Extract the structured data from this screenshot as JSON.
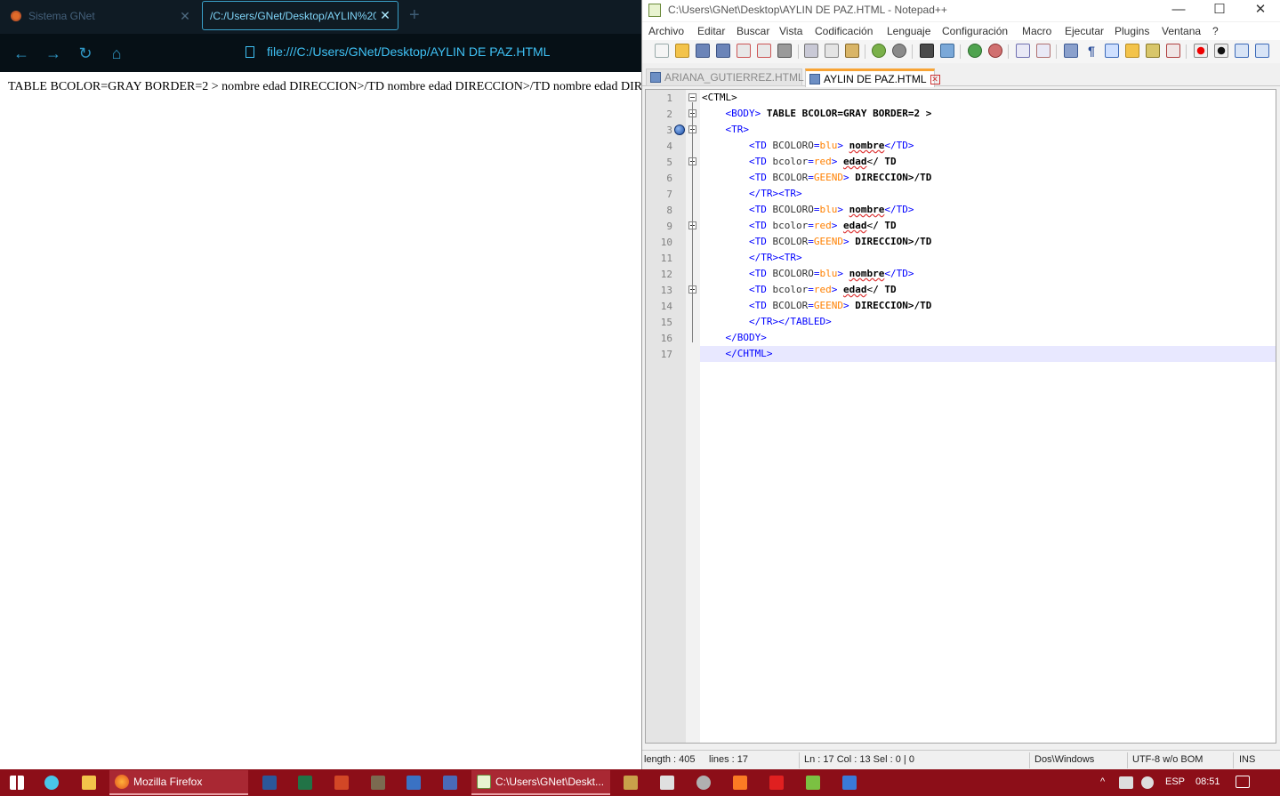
{
  "firefox": {
    "tabs": [
      {
        "title": "Sistema GNet",
        "active": false
      },
      {
        "title": "/C:/Users/GNet/Desktop/AYLIN%20",
        "active": true
      }
    ],
    "new_tab": "+",
    "url": "file:///C:/Users/GNet/Desktop/AYLIN DE PAZ.HTML",
    "content_text": "TABLE BCOLOR=GRAY BORDER=2 > nombre edad DIRECCION>/TD nombre edad DIRECCION>/TD nombre edad DIRECCION>/TD",
    "nav": {
      "back": "←",
      "forward": "→",
      "reload": "↻",
      "home": "⌂"
    }
  },
  "notepad": {
    "title": "C:\\Users\\GNet\\Desktop\\AYLIN DE PAZ.HTML - Notepad++",
    "window_controls": {
      "minimize": "—",
      "maximize": "☐",
      "close": "✕"
    },
    "menu": [
      "Archivo",
      "Editar",
      "Buscar",
      "Vista",
      "Codificación",
      "Lenguaje",
      "Configuración",
      "Macro",
      "Ejecutar",
      "Plugins",
      "Ventana",
      "?"
    ],
    "doc_tabs": [
      {
        "label": "ARIANA_GUTIERREZ.HTML",
        "active": false
      },
      {
        "label": "AYLIN DE PAZ.HTML",
        "active": true
      }
    ],
    "line_numbers": [
      "1",
      "2",
      "3",
      "4",
      "5",
      "6",
      "7",
      "8",
      "9",
      "10",
      "11",
      "12",
      "13",
      "14",
      "15",
      "16",
      "17"
    ],
    "code_lines": [
      "<CTML>",
      "    <BODY> TABLE BCOLOR=GRAY BORDER=2 >",
      "    <TR>",
      "        <TD BCOLORO=blu> nombre</TD>",
      "        <TD bcolor=red> edad</ TD",
      "        <TD BCOLOR=GEEND> DIRECCION>/TD",
      "        </TR><TR>",
      "        <TD BCOLORO=blu> nombre</TD>",
      "        <TD bcolor=red> edad</ TD",
      "        <TD BCOLOR=GEEND> DIRECCION>/TD",
      "        </TR><TR>",
      "        <TD BCOLORO=blu> nombre</TD>",
      "        <TD bcolor=red> edad</ TD",
      "        <TD BCOLOR=GEEND> DIRECCION>/TD",
      "        </TR></TABLED>",
      "    </BODY>",
      "    </CHTML>"
    ],
    "status": {
      "length": "length : 405",
      "lines": "lines : 17",
      "position": "Ln : 17    Col : 13    Sel : 0 | 0",
      "eol": "Dos\\Windows",
      "encoding": "UTF-8 w/o BOM",
      "mode": "INS"
    }
  },
  "taskbar": {
    "buttons": [
      {
        "label": "Mozilla Firefox"
      },
      {
        "label": "C:\\Users\\GNet\\Deskt..."
      }
    ],
    "tray": {
      "language": "ESP",
      "time": "08:51"
    }
  },
  "colors": {
    "firefox_tabbar": "#0f1b24",
    "firefox_accent": "#3fc1f4",
    "taskbar": "#8c0e18",
    "npp_tag": "#0000ff",
    "npp_value": "#ff8000",
    "npp_current_line": "#e8e8ff"
  }
}
